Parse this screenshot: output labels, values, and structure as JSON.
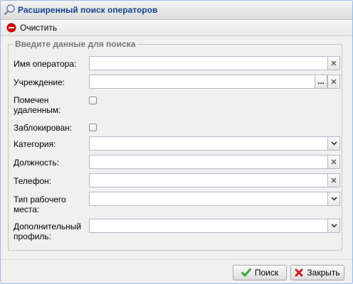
{
  "window": {
    "title": "Расширенный поиск операторов"
  },
  "toolbar": {
    "clear_label": "Очистить"
  },
  "form": {
    "legend": "Введите данные для поиска",
    "operator_name": {
      "label": "Имя оператора:",
      "value": ""
    },
    "institution": {
      "label": "Учреждение:",
      "value": "",
      "browse_glyph": "..."
    },
    "marked_deleted": {
      "label_line1": "Помечен",
      "label_line2": "удаленным:",
      "checked": false
    },
    "blocked": {
      "label": "Заблокирован:",
      "checked": false
    },
    "category": {
      "label": "Категория:",
      "value": ""
    },
    "position": {
      "label": "Должность:",
      "value": ""
    },
    "phone": {
      "label": "Телефон:",
      "value": ""
    },
    "workplace_type": {
      "label_line1": "Тип рабочего",
      "label_line2": "места:",
      "value": ""
    },
    "additional_profile": {
      "label_line1": "Дополнительный",
      "label_line2": "профиль:",
      "value": ""
    }
  },
  "footer": {
    "search_label": "Поиск",
    "close_label": "Закрыть"
  },
  "colors": {
    "title_text": "#15428b",
    "clear_icon": "#cc0000",
    "search_icon": "#3aa53a",
    "close_icon": "#d42020"
  }
}
